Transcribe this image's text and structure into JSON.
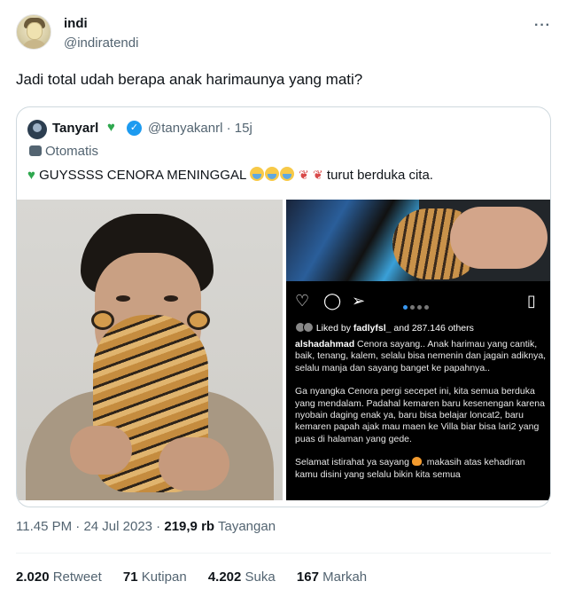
{
  "tweet": {
    "display_name": "indi",
    "handle": "@indiratendi",
    "more_icon": "ellipsis-icon",
    "text": "Jadi total udah berapa anak harimaunya yang mati?"
  },
  "quote": {
    "name": "Tanyarl",
    "handle_time": "@tanyakanrl · 15j",
    "automated_label": "Otomatis",
    "text_main": "GUYSSSS CENORA MENINGGAL",
    "text_tail": "turut berduka cita.",
    "accent_green": "#2fa84f",
    "verified_color": "#1d9bf0"
  },
  "instagram": {
    "liked_by_prefix": "Liked by",
    "liked_by_user": "fadlyfsl_",
    "liked_by_suffix": "and 287.146 others",
    "caption_user": "alshadahmad",
    "caption_p1": "Cenora sayang.. Anak harimau yang cantik, baik, tenang, kalem, selalu bisa nemenin dan jagain adiknya, selalu manja dan sayang banget ke papahnya..",
    "caption_p2": "Ga nyangka Cenora pergi secepet ini, kita semua berduka yang mendalam. Padahal kemaren baru kesenengan karena nyobain daging enak ya, baru bisa belajar loncat2, baru kemaren papah ajak mau maen ke Villa biar bisa lari2 yang puas di halaman yang gede.",
    "caption_p3a": "Selamat istirahat ya sayang",
    "caption_p3b": ", makasih atas kehadiran kamu disini yang selalu bikin kita semua"
  },
  "meta": {
    "time": "11.45 PM",
    "date": "24 Jul 2023",
    "views_count": "219,9 rb",
    "views_label": "Tayangan"
  },
  "stats": {
    "retweets_count": "2.020",
    "retweets_label": "Retweet",
    "quotes_count": "71",
    "quotes_label": "Kutipan",
    "likes_count": "4.202",
    "likes_label": "Suka",
    "bookmarks_count": "167",
    "bookmarks_label": "Markah"
  }
}
